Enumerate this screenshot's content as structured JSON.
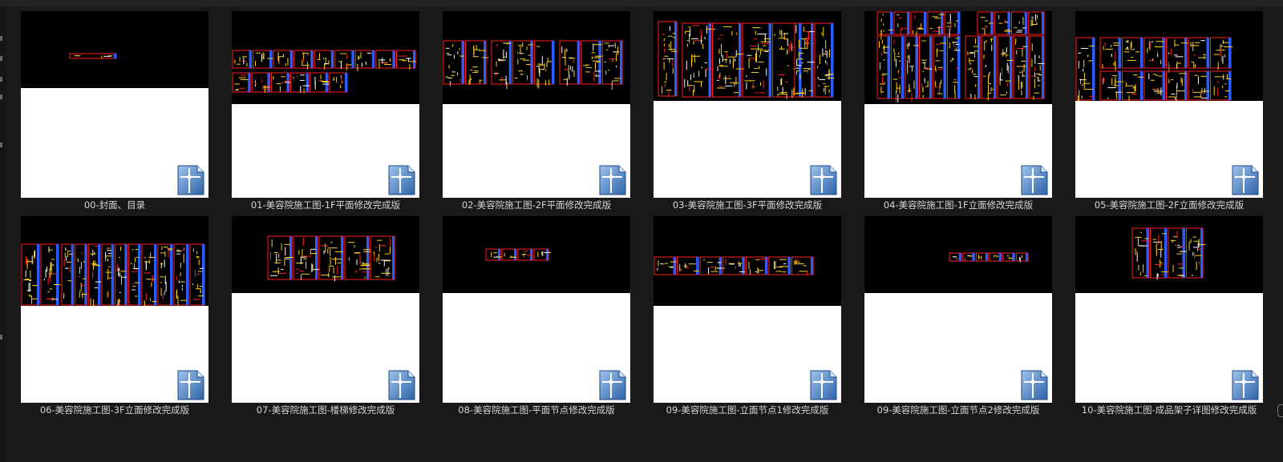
{
  "window": {
    "view": "large-icons",
    "selected_count": 0
  },
  "files": [
    {
      "name": "00-封面、目录",
      "icon": "dwg-file-icon"
    },
    {
      "name": "01-美容院施工图-1F平面修改完成版",
      "icon": "dwg-file-icon"
    },
    {
      "name": "02-美容院施工图-2F平面修改完成版",
      "icon": "dwg-file-icon"
    },
    {
      "name": "03-美容院施工图-3F平面修改完成版",
      "icon": "dwg-file-icon"
    },
    {
      "name": "04-美容院施工图-1F立面修改完成版",
      "icon": "dwg-file-icon"
    },
    {
      "name": "05-美容院施工图-2F立面修改完成版",
      "icon": "dwg-file-icon"
    },
    {
      "name": "06-美容院施工图-3F立面修改完成版",
      "icon": "dwg-file-icon"
    },
    {
      "name": "07-美容院施工图-楼梯修改完成版",
      "icon": "dwg-file-icon"
    },
    {
      "name": "08-美容院施工图-平面节点修改完成版",
      "icon": "dwg-file-icon"
    },
    {
      "name": "09-美容院施工图-立面节点1修改完成版",
      "icon": "dwg-file-icon"
    },
    {
      "name": "09-美容院施工图-立面节点2修改完成版",
      "icon": "dwg-file-icon"
    },
    {
      "name": "10-美容院施工图-成品架子详图修改完成版",
      "icon": "dwg-file-icon"
    }
  ],
  "colors": {
    "background": "#191919",
    "caption_text": "#d6d6d6",
    "cad_background": "#000000",
    "cad_red": "#ff2020",
    "cad_blue": "#2a5cff",
    "cad_yellow": "#ffd21a",
    "cad_white": "#ffffff"
  }
}
